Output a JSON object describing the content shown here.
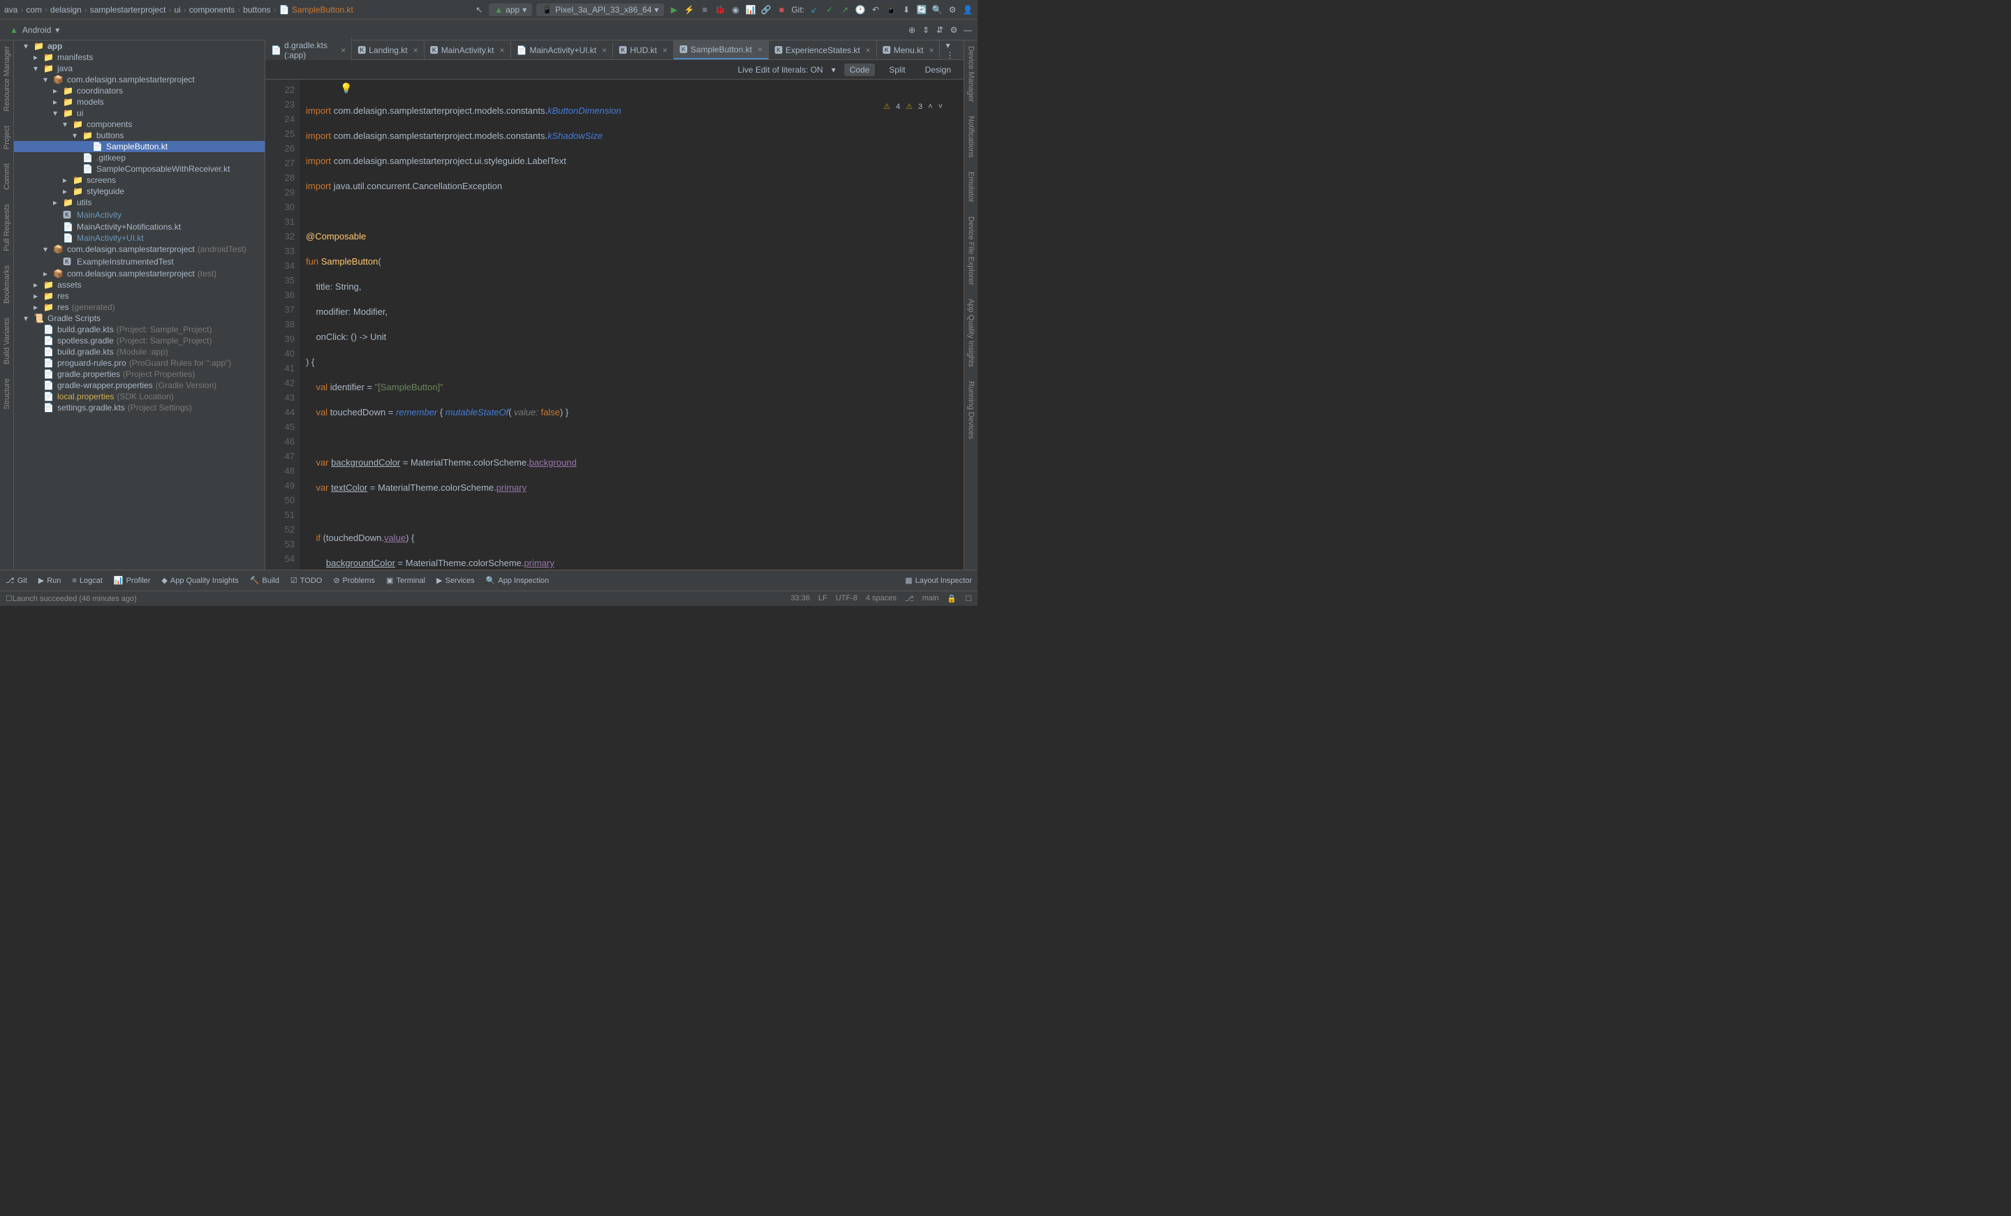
{
  "breadcrumb": [
    "ava",
    "com",
    "delasign",
    "samplestarterproject",
    "ui",
    "components",
    "buttons"
  ],
  "breadcrumb_active": "SampleButton.kt",
  "run_config": {
    "app": "app",
    "device": "Pixel_3a_API_33_x86_64"
  },
  "git_label": "Git:",
  "nav": {
    "module": "Android"
  },
  "left_tools": [
    "Resource Manager",
    "Project",
    "Commit",
    "Pull Requests",
    "Bookmarks",
    "Build Variants",
    "Structure"
  ],
  "right_tools": [
    "Device Manager",
    "Notifications",
    "Emulator",
    "Device File Explorer",
    "App Quality Insights",
    "Running Devices"
  ],
  "tree": [
    {
      "ind": 1,
      "arrow": "▾",
      "icon": "📁",
      "label": "app",
      "bold": true
    },
    {
      "ind": 2,
      "arrow": "▸",
      "icon": "📁",
      "label": "manifests"
    },
    {
      "ind": 2,
      "arrow": "▾",
      "icon": "📁",
      "label": "java"
    },
    {
      "ind": 3,
      "arrow": "▾",
      "icon": "📦",
      "label": "com.delasign.samplestarterproject"
    },
    {
      "ind": 4,
      "arrow": "▸",
      "icon": "📁",
      "label": "coordinators"
    },
    {
      "ind": 4,
      "arrow": "▸",
      "icon": "📁",
      "label": "models"
    },
    {
      "ind": 4,
      "arrow": "▾",
      "icon": "📁",
      "label": "ui"
    },
    {
      "ind": 5,
      "arrow": "▾",
      "icon": "📁",
      "label": "components"
    },
    {
      "ind": 6,
      "arrow": "▾",
      "icon": "📁",
      "label": "buttons"
    },
    {
      "ind": 7,
      "arrow": "",
      "icon": "📄",
      "label": "SampleButton.kt",
      "selected": true
    },
    {
      "ind": 6,
      "arrow": "",
      "icon": "📄",
      "label": ".gitkeep"
    },
    {
      "ind": 6,
      "arrow": "",
      "icon": "📄",
      "label": "SampleComposableWithReceiver.kt"
    },
    {
      "ind": 5,
      "arrow": "▸",
      "icon": "📁",
      "label": "screens"
    },
    {
      "ind": 5,
      "arrow": "▸",
      "icon": "📁",
      "label": "styleguide"
    },
    {
      "ind": 4,
      "arrow": "▸",
      "icon": "📁",
      "label": "utils"
    },
    {
      "ind": 4,
      "arrow": "",
      "icon": "🅺",
      "label": "MainActivity",
      "blue": true
    },
    {
      "ind": 4,
      "arrow": "",
      "icon": "📄",
      "label": "MainActivity+Notifications.kt"
    },
    {
      "ind": 4,
      "arrow": "",
      "icon": "📄",
      "label": "MainActivity+UI.kt",
      "blue": true
    },
    {
      "ind": 3,
      "arrow": "▾",
      "icon": "📦",
      "label": "com.delasign.samplestarterproject",
      "muted": "(androidTest)"
    },
    {
      "ind": 4,
      "arrow": "",
      "icon": "🅺",
      "label": "ExampleInstrumentedTest"
    },
    {
      "ind": 3,
      "arrow": "▸",
      "icon": "📦",
      "label": "com.delasign.samplestarterproject",
      "muted": "(test)"
    },
    {
      "ind": 2,
      "arrow": "▸",
      "icon": "📁",
      "label": "assets"
    },
    {
      "ind": 2,
      "arrow": "▸",
      "icon": "📁",
      "label": "res"
    },
    {
      "ind": 2,
      "arrow": "▸",
      "icon": "📁",
      "label": "res",
      "muted": "(generated)"
    },
    {
      "ind": 1,
      "arrow": "▾",
      "icon": "📜",
      "label": "Gradle Scripts"
    },
    {
      "ind": 2,
      "arrow": "",
      "icon": "📄",
      "label": "build.gradle.kts",
      "muted": "(Project: Sample_Project)"
    },
    {
      "ind": 2,
      "arrow": "",
      "icon": "📄",
      "label": "spotless.gradle",
      "muted": "(Project: Sample_Project)"
    },
    {
      "ind": 2,
      "arrow": "",
      "icon": "📄",
      "label": "build.gradle.kts",
      "muted": "(Module :app)"
    },
    {
      "ind": 2,
      "arrow": "",
      "icon": "📄",
      "label": "proguard-rules.pro",
      "muted": "(ProGuard Rules for \":app\")"
    },
    {
      "ind": 2,
      "arrow": "",
      "icon": "📄",
      "label": "gradle.properties",
      "muted": "(Project Properties)"
    },
    {
      "ind": 2,
      "arrow": "",
      "icon": "📄",
      "label": "gradle-wrapper.properties",
      "muted": "(Gradle Version)"
    },
    {
      "ind": 2,
      "arrow": "",
      "icon": "📄",
      "label": "local.properties",
      "muted": "(SDK Location)",
      "yellow": true
    },
    {
      "ind": 2,
      "arrow": "",
      "icon": "📄",
      "label": "settings.gradle.kts",
      "muted": "(Project Settings)"
    }
  ],
  "tabs": [
    {
      "label": "d.gradle.kts (:app)",
      "icon": "📄"
    },
    {
      "label": "Landing.kt",
      "icon": "🅺"
    },
    {
      "label": "MainActivity.kt",
      "icon": "🅺"
    },
    {
      "label": "MainActivity+UI.kt",
      "icon": "📄"
    },
    {
      "label": "HUD.kt",
      "icon": "🅺"
    },
    {
      "label": "SampleButton.kt",
      "icon": "🅺",
      "active": true
    },
    {
      "label": "ExperienceStates.kt",
      "icon": "🅺"
    },
    {
      "label": "Menu.kt",
      "icon": "🅺"
    }
  ],
  "editor_toolbar": {
    "literals": "Live Edit of literals: ON",
    "modes": {
      "code": "Code",
      "split": "Split",
      "design": "Design"
    }
  },
  "warnings": {
    "warn": "4",
    "weak": "3"
  },
  "code_start_line": 22,
  "cursor": {
    "pos": "33:36"
  },
  "statusbar": {
    "tools": [
      "Git",
      "Run",
      "Logcat",
      "Profiler",
      "App Quality Insights",
      "Build",
      "TODO",
      "Problems",
      "Terminal",
      "Services",
      "App Inspection"
    ],
    "layout": "Layout Inspector"
  },
  "bottom": {
    "msg": "Launch succeeded (46 minutes ago)",
    "lf": "LF",
    "enc": "UTF-8",
    "indent": "4 spaces",
    "branch": "main"
  }
}
